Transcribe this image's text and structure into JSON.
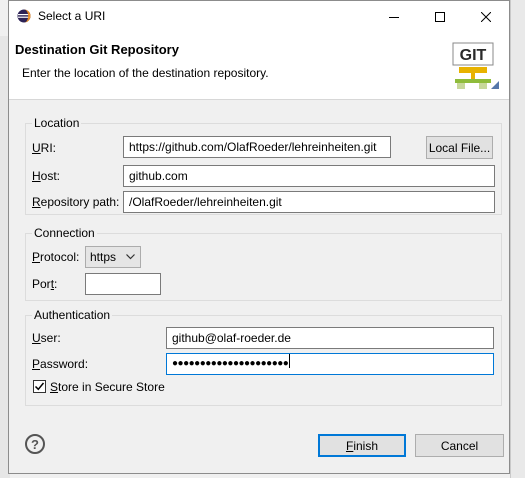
{
  "window": {
    "title": "Select a URI",
    "icons": {
      "app": "eclipse-icon",
      "minimize": "minimize-icon",
      "maximize": "maximize-icon",
      "close": "close-icon"
    }
  },
  "header": {
    "title": "Destination Git Repository",
    "description": "Enter the location of the destination repository.",
    "logo_text": "GIT"
  },
  "location": {
    "legend": "Location",
    "uri_label": "URI:",
    "uri_value": "https://github.com/OlafRoeder/lehreinheiten.git",
    "local_file_button": "Local File...",
    "host_label": "Host:",
    "host_value": "github.com",
    "path_label": "Repository path:",
    "path_value": "/OlafRoeder/lehreinheiten.git"
  },
  "connection": {
    "legend": "Connection",
    "protocol_label": "Protocol:",
    "protocol_value": "https",
    "port_label": "Port:",
    "port_value": ""
  },
  "authentication": {
    "legend": "Authentication",
    "user_label": "User:",
    "user_value": "github@olaf-roeder.de",
    "password_label": "Password:",
    "password_mask": "●●●●●●●●●●●●●●●●●●●●●",
    "store_label": "Store in Secure Store",
    "store_checked": true
  },
  "footer": {
    "help_icon": "help-icon",
    "finish_label": "Finish",
    "cancel_label": "Cancel"
  },
  "colors": {
    "focus": "#0078d7",
    "dialog_bg": "#f0f0f0",
    "header_bg": "#ffffff"
  }
}
